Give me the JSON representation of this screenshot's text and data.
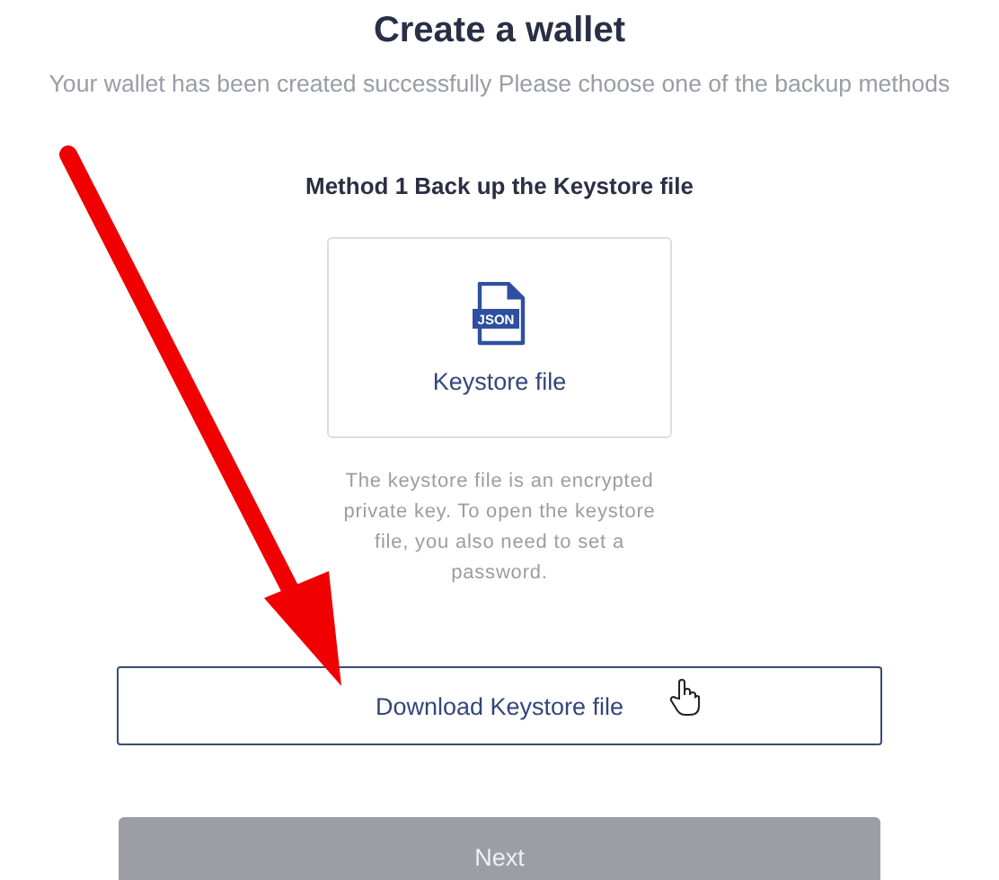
{
  "title": "Create a wallet",
  "subtitle": "Your wallet has been created successfully Please choose one of the backup methods",
  "method": {
    "heading": "Method 1 Back up the Keystore file",
    "card": {
      "badge": "JSON",
      "label": "Keystore file"
    },
    "description": "The keystore file is an encrypted private key. To open the keystore file, you also need to set a password."
  },
  "download_button": {
    "label": "Download Keystore file"
  },
  "next_button": {
    "label": "Next",
    "disabled": true
  }
}
